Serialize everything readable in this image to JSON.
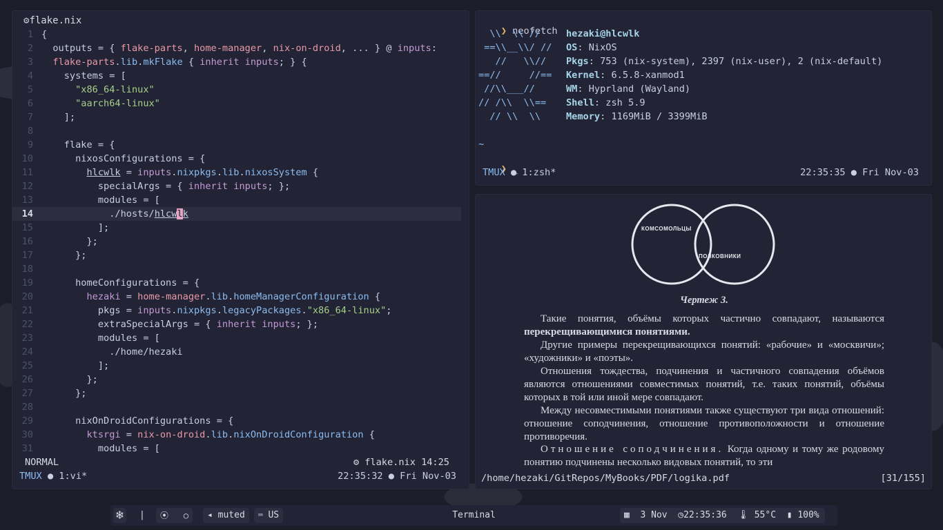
{
  "editor": {
    "title": "flake.nix",
    "lines": [
      {
        "n": "1",
        "html": "{"
      },
      {
        "n": "2",
        "html": "  outputs = { <span class='id'>flake-parts</span>, <span class='id'>home-manager</span>, <span class='id'>nix-on-droid</span>, ... } @ <span class='kw'>inputs</span>:"
      },
      {
        "n": "3",
        "html": "  <span class='id'>flake-parts</span>.<span class='fn'>lib</span>.<span class='fn'>mkFlake</span> { <span class='kw'>inherit</span> <span class='kw'>inputs</span>; } {"
      },
      {
        "n": "4",
        "html": "    systems = ["
      },
      {
        "n": "5",
        "html": "      <span class='str'>\"x86_64-linux\"</span>"
      },
      {
        "n": "6",
        "html": "      <span class='str'>\"aarch64-linux\"</span>"
      },
      {
        "n": "7",
        "html": "    ];"
      },
      {
        "n": "8",
        "html": ""
      },
      {
        "n": "9",
        "html": "    flake = {"
      },
      {
        "n": "10",
        "html": "      nixosConfigurations = {"
      },
      {
        "n": "11",
        "html": "        <span class='ul'>hlcwlk</span> = <span class='kw'>inputs</span>.<span class='fn'>nixpkgs</span>.<span class='fn'>lib</span>.<span class='fn'>nixosSystem</span> {"
      },
      {
        "n": "12",
        "html": "          specialArgs = { <span class='kw'>inherit</span> <span class='kw'>inputs</span>; };"
      },
      {
        "n": "13",
        "html": "          modules = ["
      },
      {
        "n": "14",
        "html": "            ./hosts/<span class='ul'>hlcw</span><span class='cursor'>l</span><span class='ul'>k</span>",
        "cur": true
      },
      {
        "n": "15",
        "html": "          ];"
      },
      {
        "n": "16",
        "html": "        };"
      },
      {
        "n": "17",
        "html": "      };"
      },
      {
        "n": "18",
        "html": ""
      },
      {
        "n": "19",
        "html": "      homeConfigurations = {"
      },
      {
        "n": "20",
        "html": "        <span class='kw'>hezaki</span> = <span class='id'>home-manager</span>.<span class='fn'>lib</span>.<span class='fn'>homeManagerConfiguration</span> {"
      },
      {
        "n": "21",
        "html": "          pkgs = <span class='kw'>inputs</span>.<span class='fn'>nixpkgs</span>.<span class='fn'>legacyPackages</span>.<span class='str'>\"x86_64-linux\"</span>;"
      },
      {
        "n": "22",
        "html": "          extraSpecialArgs = { <span class='kw'>inherit</span> <span class='kw'>inputs</span>; };"
      },
      {
        "n": "23",
        "html": "          modules = ["
      },
      {
        "n": "24",
        "html": "            ./home/hezaki"
      },
      {
        "n": "25",
        "html": "          ];"
      },
      {
        "n": "26",
        "html": "        };"
      },
      {
        "n": "27",
        "html": "      };"
      },
      {
        "n": "28",
        "html": ""
      },
      {
        "n": "29",
        "html": "      nixOnDroidConfigurations = {"
      },
      {
        "n": "30",
        "html": "        <span class='kw'>ktsrgi</span> = <span class='id'>nix-on-droid</span>.<span class='fn'>lib</span>.<span class='fn'>nixOnDroidConfiguration</span> {"
      },
      {
        "n": "31",
        "html": "          modules = ["
      }
    ],
    "mode": "NORMAL",
    "file_status": "⚙ flake.nix  14:25",
    "tmux_label": "TMUX",
    "tmux_window": "● 1:vi*",
    "tmux_time": "22:35:32 ● Fri Nov-03"
  },
  "terminal": {
    "prompt_symbol": "❯",
    "command": "neofetch",
    "logo": [
      "  \\\\  \\\\ //",
      " ==\\\\__\\\\/ //",
      "   //   \\\\//",
      "==//     //==",
      " //\\\\___//",
      "// /\\\\  \\\\==",
      "  // \\\\  \\\\"
    ],
    "user": "hezaki@hlcwlk",
    "info": [
      {
        "label": "OS",
        "value": "NixOS"
      },
      {
        "label": "Pkgs",
        "value": "753 (nix-system), 2397 (nix-user), 2 (nix-default)"
      },
      {
        "label": "Kernel",
        "value": "6.5.8-xanmod1"
      },
      {
        "label": "WM",
        "value": "Hyprland (Wayland)"
      },
      {
        "label": "Shell",
        "value": "zsh 5.9"
      },
      {
        "label": "Memory",
        "value": "1169MiB / 3399MiB"
      }
    ],
    "tilde": "~",
    "cursor": "_",
    "tmux_label": "TMUX",
    "tmux_window": "● 1:zsh*",
    "tmux_time": "22:35:35 ● Fri Nov-03"
  },
  "pdf": {
    "venn_left": "КОМСОМОЛЬЦЫ",
    "venn_right": "ПОЛКОВНИКИ",
    "caption": "Чертеж 3.",
    "p1_text": "Такие понятия, объёмы которых частично совпадают, называются ",
    "p1_bold": "перекрещивающимися понятиями.",
    "p2": "Другие примеры перекрещивающихся понятий: «рабочие» и «москвичи»; «художники» и «поэты».",
    "p3": "Отношения тождества, подчинения и частичного совпадения объёмов являются отношениями совместимых понятий, т.е. таких понятий, объёмы которых в той или иной мере совпадают.",
    "p4": "Между несовместимыми понятиями также существуют три вида отношений: отношение соподчинения, отношение противоположности и отношение противоречия.",
    "p5_spaced": "Отношение соподчинения.",
    "p5": " Когда одному и тому же родовому понятию подчинены несколько видовых понятий, то эти",
    "path": "/home/hezaki/GitRepos/MyBooks/PDF/logika.pdf",
    "page": "[31/155]"
  },
  "bar": {
    "mute": "muted",
    "layout": "US",
    "title": "Terminal",
    "date": "3 Nov",
    "time": "22:35:36",
    "temp": "55°C",
    "battery": "100%",
    "separator": "|"
  }
}
